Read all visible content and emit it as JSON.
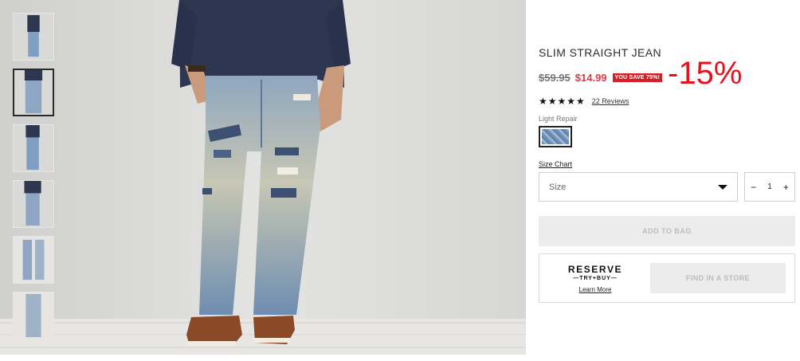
{
  "product": {
    "title": "SLIM STRAIGHT JEAN",
    "old_price": "$59.95",
    "new_price": "$14.99",
    "save_badge": "YOU SAVE 75%!",
    "promo_overlay": "-15%",
    "stars": "★★★★★",
    "rating": 5,
    "reviews_link": "22 Reviews",
    "color_label": "Light Repair",
    "size_chart_link": "Size Chart",
    "size_placeholder": "Size",
    "qty_minus": "−",
    "qty_value": "1",
    "qty_plus": "+",
    "add_to_bag": "ADD TO BAG",
    "reserve_title": "RESERVE",
    "reserve_sub": "—TRY+BUY—",
    "learn_more": "Learn More",
    "find_in_store": "FIND IN A STORE"
  },
  "gallery": {
    "thumb_count": 6,
    "active_index": 1
  },
  "colors": {
    "sale_red": "#e03a3e",
    "badge_red": "#d81f26",
    "promo_red": "#e4121b",
    "disabled_bg": "#ececec",
    "disabled_text": "#bcbcbc",
    "denim": "#7f9fc2"
  },
  "icons": [
    "chevron-down-icon",
    "minus-icon",
    "plus-icon",
    "star-icon"
  ]
}
